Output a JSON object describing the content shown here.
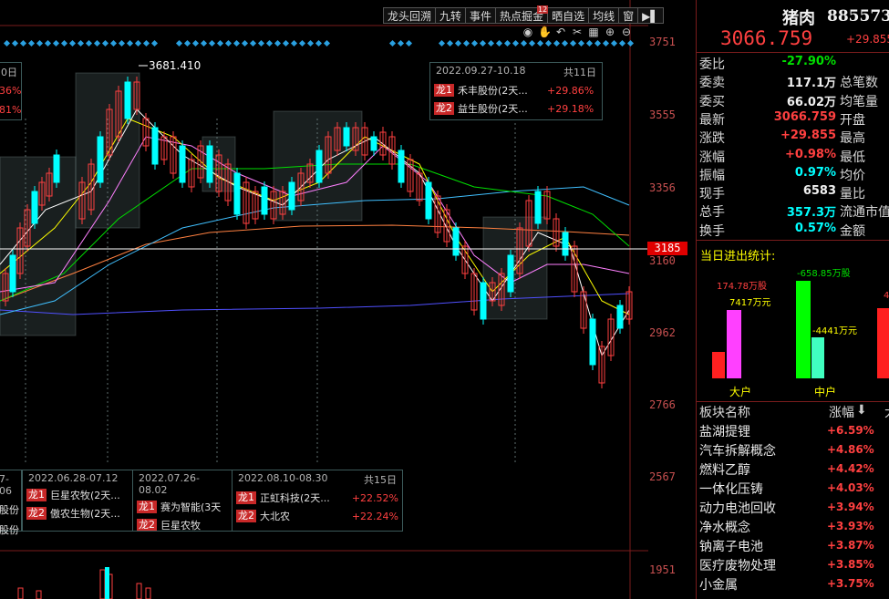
{
  "toolbar": {
    "buttons": [
      "龙头回溯",
      "九转",
      "事件",
      "热点掘金",
      "晒自选",
      "均线",
      "窗"
    ],
    "badge": "12"
  },
  "axis": {
    "price_labels": [
      "3751",
      "3555",
      "3356",
      "3160",
      "2962",
      "2766",
      "2567",
      "1951"
    ],
    "current_price_tag": "3185"
  },
  "chart": {
    "peak_label": "3681.410"
  },
  "info_boxes": {
    "top": {
      "date_range": "2022.09.27-10.18",
      "days": "共11日",
      "rows": [
        {
          "tag": "龙1",
          "stock": "禾丰股份(2天...",
          "pct": "+29.86%"
        },
        {
          "tag": "龙2",
          "stock": "益生股份(2天...",
          "pct": "+29.18%"
        }
      ]
    },
    "top_left_partial": {
      "days": "0日",
      "pct1": "36%",
      "pct2": "81%"
    },
    "bottom": {
      "partial_date": "7-06",
      "partial_row1": "股份",
      "partial_row2": "股份",
      "box1": {
        "date_range": "2022.06.28-07.12",
        "rows": [
          {
            "tag": "龙1",
            "stock": "巨星农牧(2天..."
          },
          {
            "tag": "龙2",
            "stock": "傲农生物(2天..."
          }
        ]
      },
      "box2": {
        "date_range": "2022.07.26-08.02",
        "rows": [
          {
            "tag": "龙1",
            "stock": "赛为智能(3天"
          },
          {
            "tag": "龙2",
            "stock": "巨星农牧"
          }
        ]
      },
      "box3": {
        "date_range": "2022.08.10-08.30",
        "days": "共15日",
        "rows": [
          {
            "tag": "龙1",
            "stock": "正虹科技(2天...",
            "pct": "+22.52%"
          },
          {
            "tag": "龙2",
            "stock": "大北农",
            "pct": "+22.24%"
          }
        ]
      }
    }
  },
  "right_panel": {
    "name": "猪肉",
    "code": "885573",
    "price": "3066.759",
    "change": "+29.855",
    "quotes": [
      {
        "label": "委比",
        "value": "-27.90%",
        "color": "green",
        "label2": ""
      },
      {
        "label": "委卖",
        "value": "117.1万",
        "color": "white",
        "label2": "总笔数"
      },
      {
        "label": "委买",
        "value": "66.02万",
        "color": "white",
        "label2": "均笔量"
      },
      {
        "label": "最新",
        "value": "3066.759",
        "color": "red",
        "label2": "开盘"
      },
      {
        "label": "涨跌",
        "value": "+29.855",
        "color": "red",
        "label2": "最高"
      },
      {
        "label": "涨幅",
        "value": "+0.98%",
        "color": "red",
        "label2": "最低"
      },
      {
        "label": "振幅",
        "value": "0.97%",
        "color": "cyan",
        "label2": "均价"
      },
      {
        "label": "现手",
        "value": "6583",
        "color": "white",
        "label2": "量比"
      },
      {
        "label": "总手",
        "value": "357.3万",
        "color": "cyan",
        "label2": "流通市值"
      },
      {
        "label": "换手",
        "value": "0.57%",
        "color": "cyan",
        "label2": "金额"
      }
    ],
    "stats_title": "当日进出统计:",
    "flow": {
      "big_in": "174.78万股",
      "big_amt": "7417万元",
      "mid_in": "-658.85万股",
      "mid_amt": "-4441万元",
      "partial": "4",
      "big_caption": "大户",
      "mid_caption": "中户"
    },
    "sector_header": {
      "name": "板块名称",
      "pct": "涨幅",
      "extra": "大"
    },
    "sectors": [
      {
        "name": "盐湖提锂",
        "pct": "+6.59%"
      },
      {
        "name": "汽车拆解概念",
        "pct": "+4.86%"
      },
      {
        "name": "燃料乙醇",
        "pct": "+4.42%"
      },
      {
        "name": "一体化压铸",
        "pct": "+4.03%"
      },
      {
        "name": "动力电池回收",
        "pct": "+3.94%"
      },
      {
        "name": "净水概念",
        "pct": "+3.93%"
      },
      {
        "name": "钠离子电池",
        "pct": "+3.87%"
      },
      {
        "name": "医疗废物处理",
        "pct": "+3.85%"
      },
      {
        "name": "小金属",
        "pct": "+3.75%"
      }
    ]
  },
  "colors": {
    "up": "#ff4040",
    "down": "#00ffff",
    "ma5": "#ffffff",
    "ma10": "#ffff00",
    "ma20": "#ff80ff",
    "ma30": "#00e000",
    "ma60": "#40c0ff",
    "ma120": "#ff8040",
    "ma250": "#5050ff"
  }
}
